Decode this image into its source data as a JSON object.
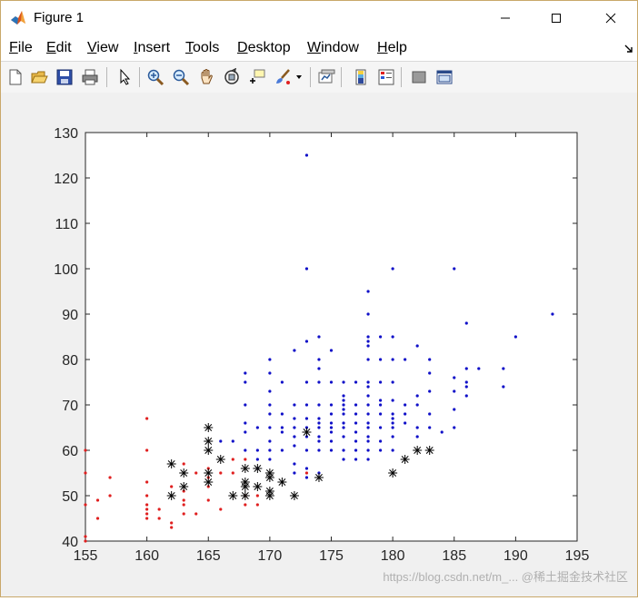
{
  "window": {
    "title": "Figure 1",
    "controls": {
      "minimize": "minimize",
      "maximize": "maximize",
      "close": "close"
    }
  },
  "menu": {
    "items": [
      {
        "label": "File",
        "u": "F",
        "rest": "ile"
      },
      {
        "label": "Edit",
        "u": "E",
        "rest": "dit"
      },
      {
        "label": "View",
        "u": "V",
        "rest": "iew"
      },
      {
        "label": "Insert",
        "u": "I",
        "rest": "nsert"
      },
      {
        "label": "Tools",
        "u": "T",
        "rest": "ools"
      },
      {
        "label": "Desktop",
        "u": "D",
        "rest": "esktop"
      },
      {
        "label": "Window",
        "u": "W",
        "rest": "indow"
      },
      {
        "label": "Help",
        "u": "H",
        "rest": "elp"
      }
    ]
  },
  "toolbar": {
    "icons": [
      "new-figure-icon",
      "open-file-icon",
      "save-icon",
      "print-icon",
      "pointer-icon",
      "zoom-in-icon",
      "zoom-out-icon",
      "pan-hand-icon",
      "rotate-3d-icon",
      "data-cursor-icon",
      "brush-icon",
      "brush-dropdown-icon",
      "link-plot-icon",
      "insert-colorbar-icon",
      "insert-legend-icon",
      "hide-plot-tools-icon",
      "show-plot-tools-icon"
    ]
  },
  "colors": {
    "red": "#e02020",
    "blue": "#1010c8",
    "black": "#000000",
    "axes_bg": "#ffffff",
    "figure_bg": "#f0f0f0"
  },
  "watermark": "https://blog.csdn.net/m_... @稀土掘金技术社区",
  "chart_data": {
    "type": "scatter",
    "title": "",
    "xlabel": "",
    "ylabel": "",
    "xlim": [
      155,
      195
    ],
    "ylim": [
      40,
      130
    ],
    "xticks": [
      155,
      160,
      165,
      170,
      175,
      180,
      185,
      190,
      195
    ],
    "yticks": [
      40,
      50,
      60,
      70,
      80,
      90,
      100,
      110,
      120,
      130
    ],
    "grid": false,
    "legend": "none",
    "series": [
      {
        "color": "#e02020",
        "marker": "dot",
        "points": [
          [
            155,
            60
          ],
          [
            155,
            55
          ],
          [
            155,
            48
          ],
          [
            155,
            41
          ],
          [
            155,
            40
          ],
          [
            156,
            49
          ],
          [
            156,
            45
          ],
          [
            157,
            54
          ],
          [
            157,
            50
          ],
          [
            160,
            67
          ],
          [
            160,
            60
          ],
          [
            160,
            53
          ],
          [
            160,
            50
          ],
          [
            160,
            48
          ],
          [
            160,
            47
          ],
          [
            160,
            46
          ],
          [
            160,
            45
          ],
          [
            161,
            47
          ],
          [
            161,
            45
          ],
          [
            162,
            52
          ],
          [
            162,
            44
          ],
          [
            162,
            43
          ],
          [
            163,
            57
          ],
          [
            163,
            51
          ],
          [
            163,
            49
          ],
          [
            163,
            48
          ],
          [
            163,
            46
          ],
          [
            164,
            55
          ],
          [
            164,
            46
          ],
          [
            165,
            56
          ],
          [
            165,
            54
          ],
          [
            165,
            52
          ],
          [
            165,
            49
          ],
          [
            166,
            55
          ],
          [
            166,
            47
          ],
          [
            167,
            58
          ],
          [
            167,
            55
          ],
          [
            168,
            58
          ],
          [
            168,
            50
          ],
          [
            168,
            48
          ],
          [
            169,
            50
          ],
          [
            169,
            48
          ],
          [
            173,
            55
          ]
        ]
      },
      {
        "color": "#1010c8",
        "marker": "dot",
        "points": [
          [
            166,
            62
          ],
          [
            167,
            62
          ],
          [
            168,
            77
          ],
          [
            168,
            75
          ],
          [
            168,
            70
          ],
          [
            168,
            66
          ],
          [
            168,
            64
          ],
          [
            168,
            60
          ],
          [
            169,
            65
          ],
          [
            169,
            60
          ],
          [
            169,
            58
          ],
          [
            169,
            56
          ],
          [
            170,
            80
          ],
          [
            170,
            77
          ],
          [
            170,
            73
          ],
          [
            170,
            70
          ],
          [
            170,
            68
          ],
          [
            170,
            65
          ],
          [
            170,
            62
          ],
          [
            170,
            60
          ],
          [
            170,
            58
          ],
          [
            171,
            75
          ],
          [
            171,
            68
          ],
          [
            171,
            65
          ],
          [
            171,
            64
          ],
          [
            171,
            60
          ],
          [
            172,
            82
          ],
          [
            172,
            70
          ],
          [
            172,
            67
          ],
          [
            172,
            65
          ],
          [
            172,
            63
          ],
          [
            172,
            61
          ],
          [
            172,
            57
          ],
          [
            172,
            55
          ],
          [
            173,
            125
          ],
          [
            173,
            100
          ],
          [
            173,
            84
          ],
          [
            173,
            75
          ],
          [
            173,
            70
          ],
          [
            173,
            67
          ],
          [
            173,
            65
          ],
          [
            173,
            63
          ],
          [
            173,
            60
          ],
          [
            173,
            56
          ],
          [
            173,
            54
          ],
          [
            174,
            85
          ],
          [
            174,
            80
          ],
          [
            174,
            78
          ],
          [
            174,
            75
          ],
          [
            174,
            70
          ],
          [
            174,
            67
          ],
          [
            174,
            66
          ],
          [
            174,
            65
          ],
          [
            174,
            63
          ],
          [
            174,
            62
          ],
          [
            174,
            60
          ],
          [
            174,
            55
          ],
          [
            175,
            82
          ],
          [
            175,
            75
          ],
          [
            175,
            70
          ],
          [
            175,
            68
          ],
          [
            175,
            66
          ],
          [
            175,
            65
          ],
          [
            175,
            64
          ],
          [
            175,
            62
          ],
          [
            175,
            60
          ],
          [
            176,
            75
          ],
          [
            176,
            72
          ],
          [
            176,
            71
          ],
          [
            176,
            70
          ],
          [
            176,
            69
          ],
          [
            176,
            68
          ],
          [
            176,
            66
          ],
          [
            176,
            65
          ],
          [
            176,
            63
          ],
          [
            176,
            60
          ],
          [
            176,
            58
          ],
          [
            177,
            75
          ],
          [
            177,
            70
          ],
          [
            177,
            68
          ],
          [
            177,
            66
          ],
          [
            177,
            64
          ],
          [
            177,
            62
          ],
          [
            177,
            60
          ],
          [
            177,
            58
          ],
          [
            178,
            95
          ],
          [
            178,
            90
          ],
          [
            178,
            85
          ],
          [
            178,
            84
          ],
          [
            178,
            83
          ],
          [
            178,
            80
          ],
          [
            178,
            75
          ],
          [
            178,
            74
          ],
          [
            178,
            72
          ],
          [
            178,
            70
          ],
          [
            178,
            68
          ],
          [
            178,
            66
          ],
          [
            178,
            65
          ],
          [
            178,
            63
          ],
          [
            178,
            62
          ],
          [
            178,
            60
          ],
          [
            178,
            58
          ],
          [
            179,
            85
          ],
          [
            179,
            80
          ],
          [
            179,
            75
          ],
          [
            179,
            71
          ],
          [
            179,
            70
          ],
          [
            179,
            68
          ],
          [
            179,
            65
          ],
          [
            179,
            62
          ],
          [
            179,
            60
          ],
          [
            180,
            100
          ],
          [
            180,
            85
          ],
          [
            180,
            80
          ],
          [
            180,
            75
          ],
          [
            180,
            71
          ],
          [
            180,
            68
          ],
          [
            180,
            67
          ],
          [
            180,
            66
          ],
          [
            180,
            65
          ],
          [
            180,
            63
          ],
          [
            180,
            60
          ],
          [
            181,
            80
          ],
          [
            181,
            70
          ],
          [
            181,
            68
          ],
          [
            181,
            66
          ],
          [
            182,
            83
          ],
          [
            182,
            72
          ],
          [
            182,
            70
          ],
          [
            182,
            65
          ],
          [
            182,
            63
          ],
          [
            183,
            80
          ],
          [
            183,
            77
          ],
          [
            183,
            73
          ],
          [
            183,
            68
          ],
          [
            183,
            65
          ],
          [
            184,
            64
          ],
          [
            185,
            100
          ],
          [
            185,
            76
          ],
          [
            185,
            73
          ],
          [
            185,
            69
          ],
          [
            185,
            65
          ],
          [
            186,
            88
          ],
          [
            186,
            78
          ],
          [
            186,
            75
          ],
          [
            186,
            74
          ],
          [
            186,
            72
          ],
          [
            187,
            78
          ],
          [
            189,
            78
          ],
          [
            189,
            74
          ],
          [
            190,
            85
          ],
          [
            193,
            90
          ]
        ]
      },
      {
        "color": "#000000",
        "marker": "asterisk",
        "points": [
          [
            162,
            57
          ],
          [
            162,
            50
          ],
          [
            163,
            55
          ],
          [
            163,
            52
          ],
          [
            165,
            65
          ],
          [
            165,
            62
          ],
          [
            165,
            60
          ],
          [
            165,
            55
          ],
          [
            165,
            53
          ],
          [
            166,
            58
          ],
          [
            167,
            50
          ],
          [
            168,
            56
          ],
          [
            168,
            53
          ],
          [
            168,
            52
          ],
          [
            168,
            50
          ],
          [
            169,
            56
          ],
          [
            169,
            52
          ],
          [
            170,
            55
          ],
          [
            170,
            54
          ],
          [
            170,
            51
          ],
          [
            170,
            50
          ],
          [
            171,
            53
          ],
          [
            172,
            50
          ],
          [
            173,
            64
          ],
          [
            174,
            54
          ],
          [
            180,
            55
          ],
          [
            181,
            58
          ],
          [
            182,
            60
          ],
          [
            183,
            60
          ]
        ]
      }
    ]
  }
}
